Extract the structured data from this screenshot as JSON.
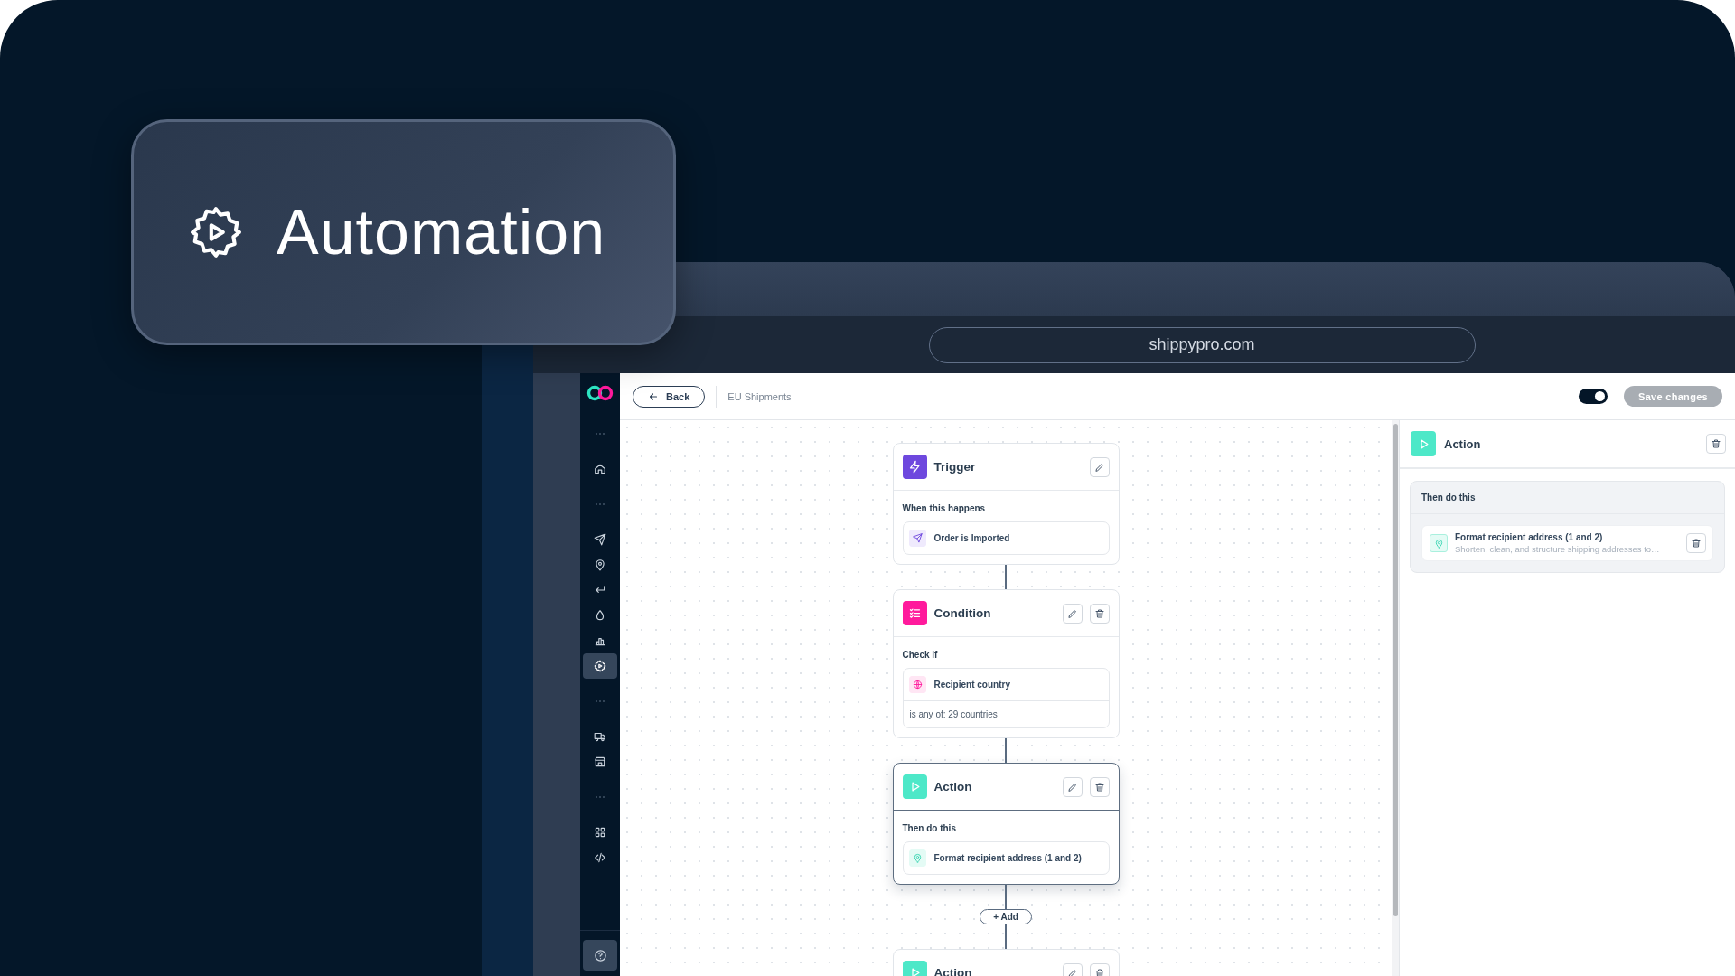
{
  "hero_badge": {
    "title": "Automation"
  },
  "browser": {
    "address": "shippypro.com"
  },
  "sidebar": {
    "items": [
      {
        "kind": "dots"
      },
      {
        "kind": "link",
        "selected": false
      },
      {
        "kind": "dots"
      },
      {
        "kind": "link",
        "selected": false
      },
      {
        "kind": "link",
        "selected": false
      },
      {
        "kind": "link",
        "selected": false
      },
      {
        "kind": "link",
        "selected": false
      },
      {
        "kind": "link",
        "selected": false
      },
      {
        "kind": "link",
        "selected": true
      },
      {
        "kind": "dots"
      },
      {
        "kind": "link",
        "selected": false
      },
      {
        "kind": "link",
        "selected": false
      },
      {
        "kind": "dots"
      },
      {
        "kind": "link",
        "selected": false
      },
      {
        "kind": "link",
        "selected": false
      }
    ]
  },
  "toolbar": {
    "back_button": "Back",
    "breadcrumb": "EU Shipments",
    "toggle": {
      "on": true
    },
    "save_button": {
      "label": "Save changes",
      "disabled": true
    }
  },
  "canvas": {
    "steps": [
      {
        "kind": "trigger",
        "title": "Trigger",
        "section_label": "When this happens",
        "item": "Order is Imported",
        "deletable": false,
        "selected": false
      },
      {
        "kind": "condition",
        "title": "Condition",
        "section_label": "Check if",
        "item": "Recipient country",
        "detail": "is any of: 29 countries",
        "deletable": true,
        "selected": false
      },
      {
        "kind": "action",
        "title": "Action",
        "section_label": "Then do this",
        "item": "Format recipient address (1 and 2)",
        "deletable": true,
        "selected": true
      },
      {
        "kind": "add",
        "label": "+ Add"
      },
      {
        "kind": "action",
        "title": "Action",
        "deletable": true,
        "selected": false
      }
    ]
  },
  "detail_panel": {
    "kind": "action",
    "title": "Action",
    "section_label": "Then do this",
    "items": [
      {
        "title": "Format recipient address (1 and 2)",
        "description": "Shorten, clean, and structure shipping addresses to…"
      }
    ]
  }
}
